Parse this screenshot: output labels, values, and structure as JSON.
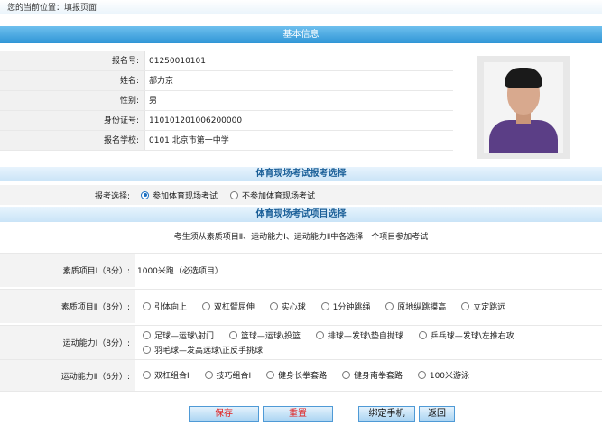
{
  "breadcrumb": "您的当前位置：填报页面",
  "sections": {
    "basic": "基本信息",
    "exam_choice": "体育现场考试报考选择",
    "item_choice": "体育现场考试项目选择"
  },
  "info": [
    {
      "label": "报名号:",
      "value": "01250010101"
    },
    {
      "label": "姓名:",
      "value": "郝力京"
    },
    {
      "label": "性别:",
      "value": "男"
    },
    {
      "label": "身份证号:",
      "value": "110101201006200000"
    },
    {
      "label": "报名学校:",
      "value": "0101 北京市第一中学"
    }
  ],
  "exam_choice": {
    "label": "报考选择:",
    "options": [
      "参加体育现场考试",
      "不参加体育现场考试"
    ],
    "selected": 0
  },
  "note": "考生须从素质项目Ⅱ、运动能力Ⅰ、运动能力Ⅱ中各选择一个项目参加考试",
  "items": [
    {
      "label": "素质项目Ⅰ（8分）:",
      "fixed": "1000米跑（必选项目）"
    },
    {
      "label": "素质项目Ⅱ（8分）:",
      "options": [
        "引体向上",
        "双杠臂屈伸",
        "实心球",
        "1分钟跳绳",
        "原地纵跳摸高",
        "立定跳远"
      ]
    },
    {
      "label": "运动能力Ⅰ（8分）:",
      "options": [
        "足球—运球\\射门",
        "篮球—运球\\投篮",
        "排球—发球\\垫自抛球",
        "乒乓球—发球\\左推右攻",
        "羽毛球—发高远球\\正反手挑球"
      ]
    },
    {
      "label": "运动能力Ⅱ（6分）:",
      "options": [
        "双杠组合Ⅰ",
        "技巧组合Ⅰ",
        "健身长拳套路",
        "健身南拳套路",
        "100米游泳"
      ]
    }
  ],
  "buttons": {
    "save": "保存",
    "reset": "重置",
    "bind_phone": "绑定手机",
    "back": "返回"
  },
  "colors": {
    "header_blue": "#2f95d6",
    "accent_red": "#e02020"
  }
}
